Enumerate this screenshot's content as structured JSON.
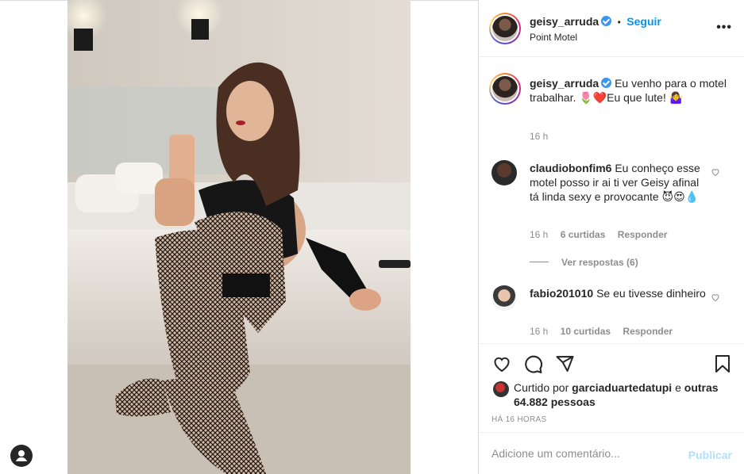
{
  "post": {
    "username": "geisy_arruda",
    "follow_label": "Seguir",
    "dot": "•",
    "location": "Point Motel",
    "more": "•••",
    "caption_user": "geisy_arruda",
    "caption": "Eu venho para o motel trabalhar. 🌷❤️Eu que lute! 🤷‍♀️",
    "caption_time": "16 h"
  },
  "comments": [
    {
      "user": "claudiobonfim6",
      "text": "Eu conheço esse motel posso ir ai ti ver Geisy afinal tá linda sexy e provocante 😈😍💧",
      "time": "16 h",
      "likes": "6 curtidas",
      "reply": "Responder",
      "replies_label": "Ver respostas (6)"
    },
    {
      "user": "fabio201010",
      "text": "Se eu tivesse dinheiro",
      "time": "16 h",
      "likes": "10 curtidas",
      "reply": "Responder"
    }
  ],
  "likes": {
    "prefix": "Curtido por",
    "user": "garciaduartedatupi",
    "suffix": "e",
    "others": "outras 64.882 pessoas",
    "time_ago": "HÁ 16 HORAS"
  },
  "add_comment": {
    "placeholder": "Adicione um comentário...",
    "publish_label": "Publicar"
  },
  "colors": {
    "accent": "#0095f6",
    "verified": "#3897f0",
    "muted": "#8e8e8e",
    "publish_disabled": "#b2dffc"
  }
}
